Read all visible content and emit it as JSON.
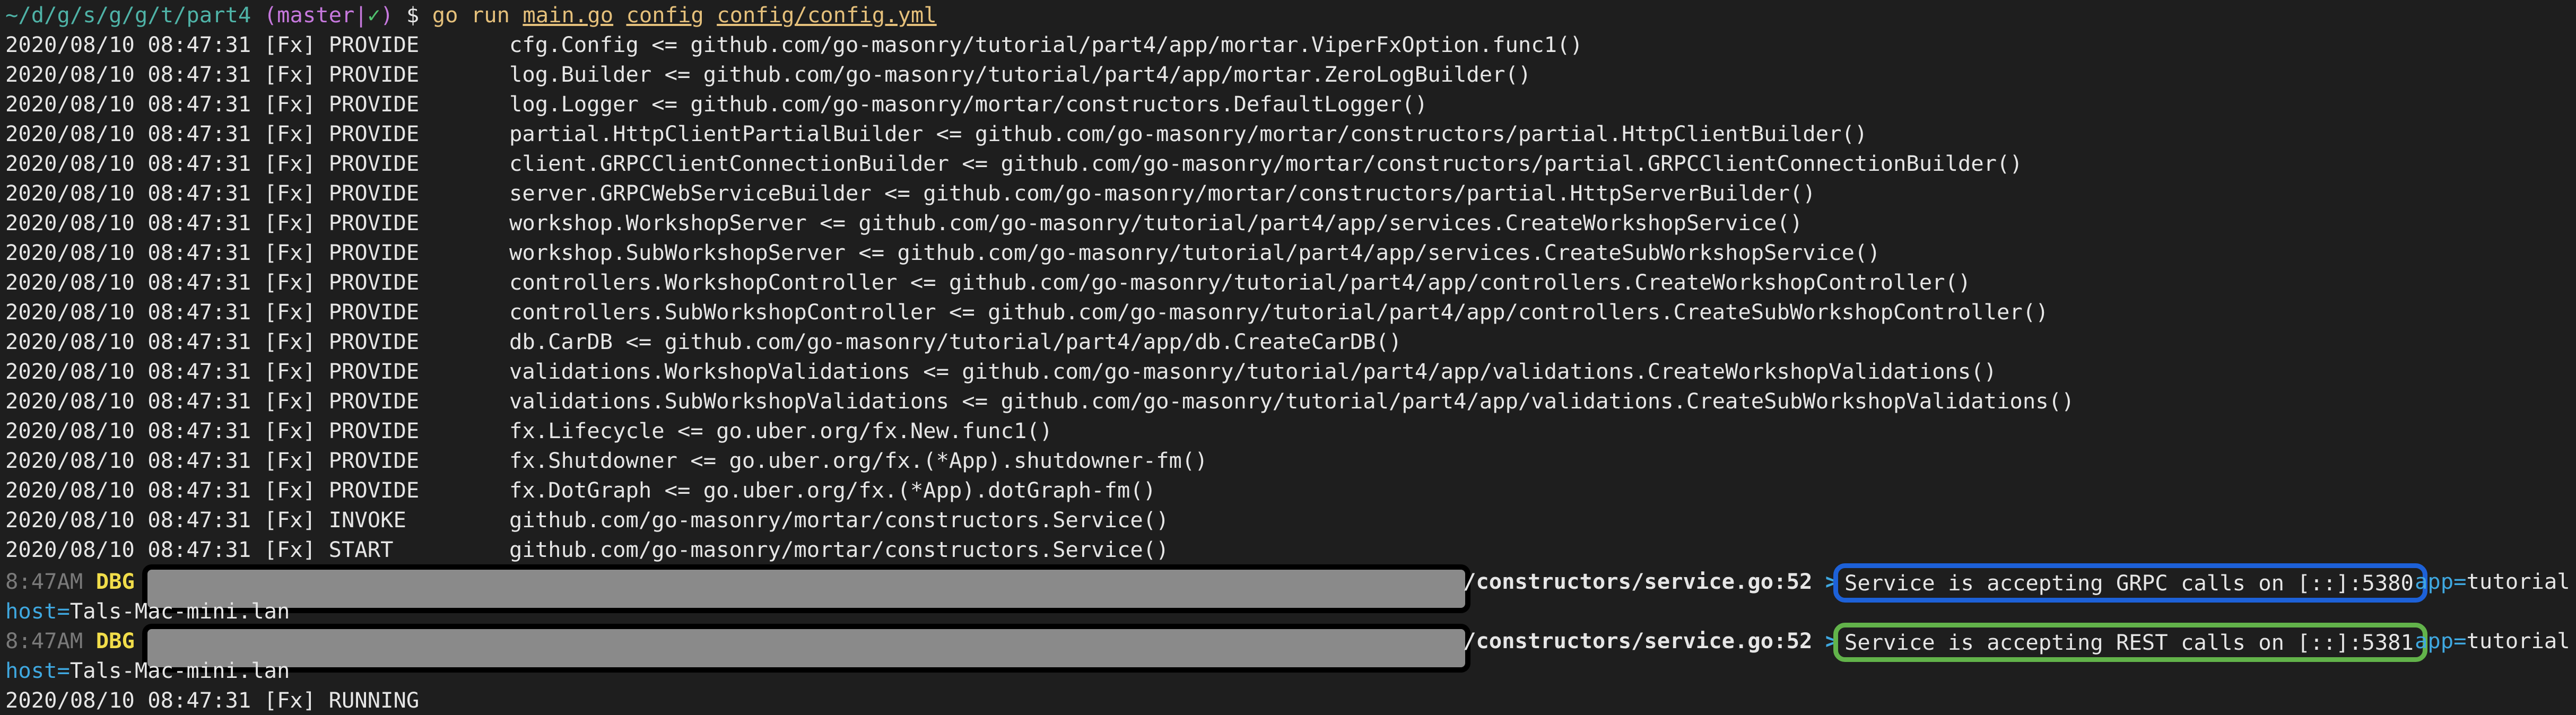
{
  "prompt": {
    "path": "~/d/g/s/g/g/t/part4",
    "branch_open": "(master",
    "branch_sep": "|",
    "branch_check": "✓",
    "branch_close": ")",
    "dollar": "$",
    "command": "go run",
    "args": [
      "main.go",
      "config",
      "config/config.yml"
    ]
  },
  "log_lines": [
    {
      "ts": "2020/08/10 08:47:31 [Fx] PROVIDE",
      "msg": "cfg.Config <= github.com/go-masonry/tutorial/part4/app/mortar.ViperFxOption.func1()"
    },
    {
      "ts": "2020/08/10 08:47:31 [Fx] PROVIDE",
      "msg": "log.Builder <= github.com/go-masonry/tutorial/part4/app/mortar.ZeroLogBuilder()"
    },
    {
      "ts": "2020/08/10 08:47:31 [Fx] PROVIDE",
      "msg": "log.Logger <= github.com/go-masonry/mortar/constructors.DefaultLogger()"
    },
    {
      "ts": "2020/08/10 08:47:31 [Fx] PROVIDE",
      "msg": "partial.HttpClientPartialBuilder <= github.com/go-masonry/mortar/constructors/partial.HttpClientBuilder()"
    },
    {
      "ts": "2020/08/10 08:47:31 [Fx] PROVIDE",
      "msg": "client.GRPCClientConnectionBuilder <= github.com/go-masonry/mortar/constructors/partial.GRPCClientConnectionBuilder()"
    },
    {
      "ts": "2020/08/10 08:47:31 [Fx] PROVIDE",
      "msg": "server.GRPCWebServiceBuilder <= github.com/go-masonry/mortar/constructors/partial.HttpServerBuilder()"
    },
    {
      "ts": "2020/08/10 08:47:31 [Fx] PROVIDE",
      "msg": "workshop.WorkshopServer <= github.com/go-masonry/tutorial/part4/app/services.CreateWorkshopService()"
    },
    {
      "ts": "2020/08/10 08:47:31 [Fx] PROVIDE",
      "msg": "workshop.SubWorkshopServer <= github.com/go-masonry/tutorial/part4/app/services.CreateSubWorkshopService()"
    },
    {
      "ts": "2020/08/10 08:47:31 [Fx] PROVIDE",
      "msg": "controllers.WorkshopController <= github.com/go-masonry/tutorial/part4/app/controllers.CreateWorkshopController()"
    },
    {
      "ts": "2020/08/10 08:47:31 [Fx] PROVIDE",
      "msg": "controllers.SubWorkshopController <= github.com/go-masonry/tutorial/part4/app/controllers.CreateSubWorkshopController()"
    },
    {
      "ts": "2020/08/10 08:47:31 [Fx] PROVIDE",
      "msg": "db.CarDB <= github.com/go-masonry/tutorial/part4/app/db.CreateCarDB()"
    },
    {
      "ts": "2020/08/10 08:47:31 [Fx] PROVIDE",
      "msg": "validations.WorkshopValidations <= github.com/go-masonry/tutorial/part4/app/validations.CreateWorkshopValidations()"
    },
    {
      "ts": "2020/08/10 08:47:31 [Fx] PROVIDE",
      "msg": "validations.SubWorkshopValidations <= github.com/go-masonry/tutorial/part4/app/validations.CreateSubWorkshopValidations()"
    },
    {
      "ts": "2020/08/10 08:47:31 [Fx] PROVIDE",
      "msg": "fx.Lifecycle <= go.uber.org/fx.New.func1()"
    },
    {
      "ts": "2020/08/10 08:47:31 [Fx] PROVIDE",
      "msg": "fx.Shutdowner <= go.uber.org/fx.(*App).shutdowner-fm()"
    },
    {
      "ts": "2020/08/10 08:47:31 [Fx] PROVIDE",
      "msg": "fx.DotGraph <= go.uber.org/fx.(*App).dotGraph-fm()"
    },
    {
      "ts": "2020/08/10 08:47:31 [Fx] INVOKE",
      "msg": "github.com/go-masonry/mortar/constructors.Service()"
    },
    {
      "ts": "2020/08/10 08:47:31 [Fx] START",
      "msg": "github.com/go-masonry/mortar/constructors.Service()"
    }
  ],
  "dbg": [
    {
      "time": "8:47AM",
      "level": "DBG",
      "caller": "/constructors/service.go:52",
      "arrow": ">",
      "message": "Service is accepting GRPC calls on [::]:5380",
      "app_key": "app=",
      "app_val": "tutorial",
      "host_key": "host=",
      "host_val": "Tals-Mac-mini.lan"
    },
    {
      "time": "8:47AM",
      "level": "DBG",
      "caller": "/constructors/service.go:52",
      "arrow": ">",
      "message": "Service is accepting REST calls on [::]:5381",
      "app_key": "app=",
      "app_val": "tutorial",
      "host_key": "host=",
      "host_val": "Tals-Mac-mini.lan"
    }
  ],
  "final_line": "2020/08/10 08:47:31 [Fx] RUNNING",
  "colors": {
    "background": "#1e1e1e",
    "grpc_highlight": "#1d61d8",
    "rest_highlight": "#62b34a",
    "dbg_level": "#f1dd4a",
    "key": "#3fa8e0"
  }
}
